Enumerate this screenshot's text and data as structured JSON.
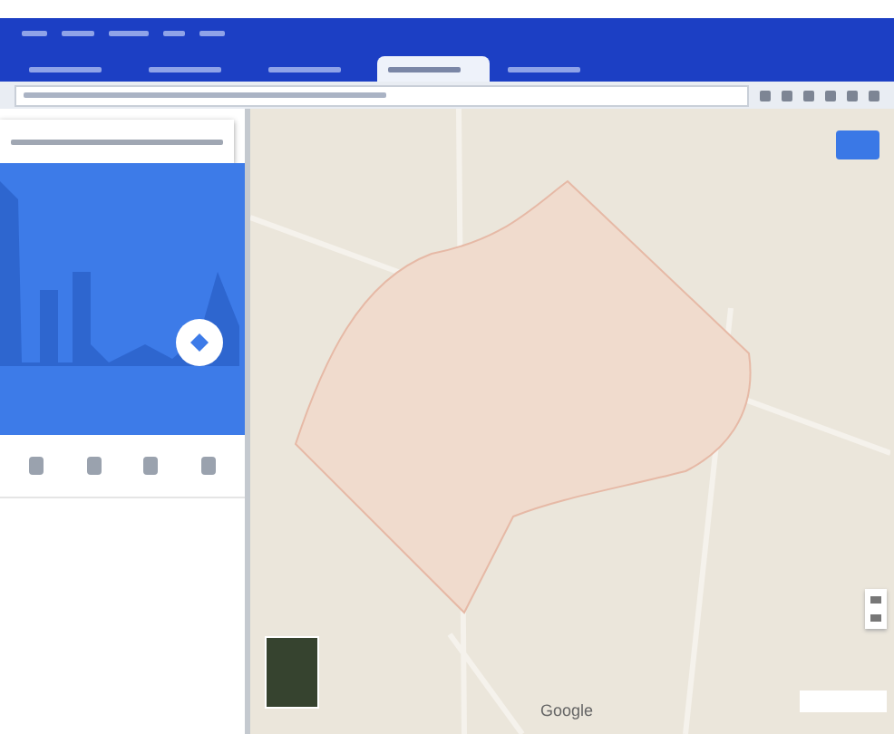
{
  "browser": {
    "tabs": [
      {
        "selected": false
      },
      {
        "selected": false
      },
      {
        "selected": false
      },
      {
        "selected": true
      },
      {
        "selected": false
      }
    ]
  },
  "map": {
    "attribution": "Google"
  }
}
